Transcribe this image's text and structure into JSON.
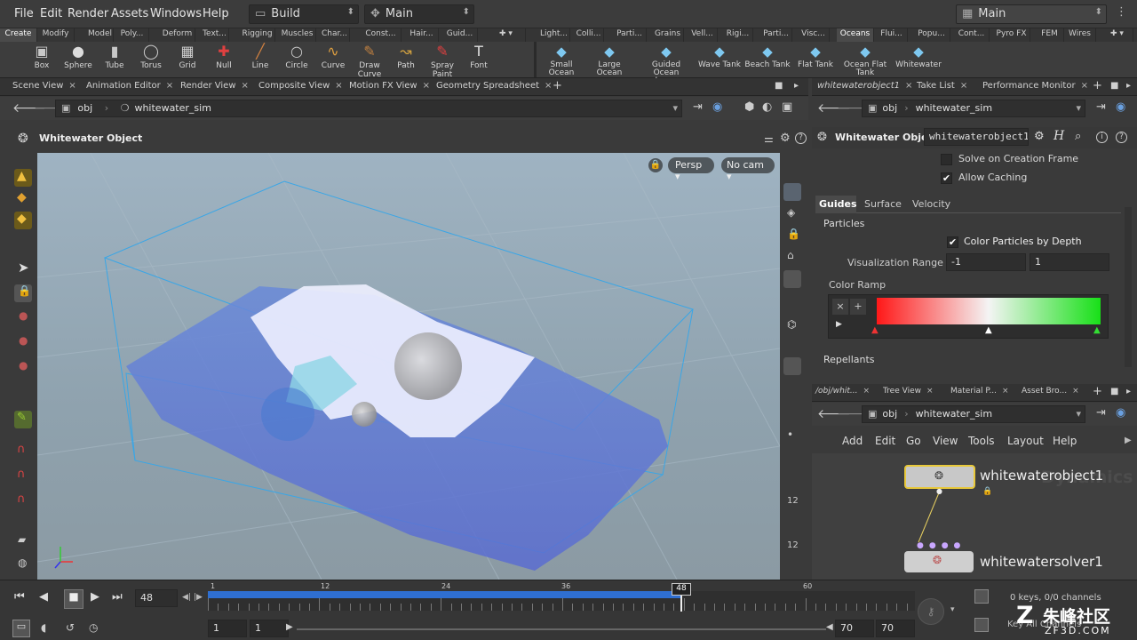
{
  "menubar": {
    "items": [
      "File",
      "Edit",
      "Render",
      "Assets",
      "Windows",
      "Help"
    ],
    "desktop": "Build",
    "context": "Main",
    "right_context": "Main"
  },
  "shelf_tabs_left": [
    "Create",
    "Modify",
    "Model",
    "Poly...",
    "Deform",
    "Text...",
    "Rigging",
    "Muscles",
    "Char...",
    "Const...",
    "Hair...",
    "Guid..."
  ],
  "shelf_tabs_right": [
    "Light...",
    "Colli...",
    "Parti...",
    "Grains",
    "Vell...",
    "Rigi...",
    "Parti...",
    "Visc...",
    "Oceans",
    "Flui...",
    "Popu...",
    "Cont...",
    "Pyro FX",
    "FEM",
    "Wires"
  ],
  "tools_left": [
    "Box",
    "Sphere",
    "Tube",
    "Torus",
    "Grid",
    "Null",
    "Line",
    "Circle",
    "Curve",
    "Draw Curve",
    "Path",
    "Spray Paint",
    "Font"
  ],
  "tools_right": [
    "Small Ocean",
    "Large Ocean",
    "Guided Ocean Layer",
    "Wave Tank",
    "Beach Tank",
    "Flat Tank",
    "Ocean Flat Tank",
    "Whitewater"
  ],
  "left_pane_tabs": [
    "Scene View",
    "Animation Editor",
    "Render View",
    "Composite View",
    "Motion FX View",
    "Geometry Spreadsheet"
  ],
  "path": {
    "root": "obj",
    "node": "whitewater_sim"
  },
  "viewport": {
    "title": "Whitewater Object",
    "camera_mode": "Persp",
    "camera": "No cam"
  },
  "parm": {
    "tabs": [
      "whitewaterobject1",
      "Take List",
      "Performance Monitor"
    ],
    "path_root": "obj",
    "path_node": "whitewater_sim",
    "type": "Whitewater Object",
    "name": "whitewaterobject1",
    "solve_on_creation": "Solve on Creation Frame",
    "allow_caching": "Allow Caching",
    "subtabs": [
      "Guides",
      "Surface",
      "Velocity"
    ],
    "particles_section": "Particles",
    "color_by_depth": "Color Particles by Depth",
    "vis_range_label": "Visualization Range",
    "vis_min": "-1",
    "vis_max": "1",
    "color_ramp_label": "Color Ramp",
    "repellants": "Repellants"
  },
  "net": {
    "tabs": [
      "/obj/whit...",
      "Tree View",
      "Material P...",
      "Asset Bro..."
    ],
    "path_root": "obj",
    "path_node": "whitewater_sim",
    "menu": [
      "Add",
      "Edit",
      "Go",
      "View",
      "Tools",
      "Layout",
      "Help"
    ],
    "node1": "whitewaterobject1",
    "node2": "whitewatersolver1",
    "watermark": "Dynamics"
  },
  "timeline": {
    "current_frame": "48",
    "ticks": [
      "1",
      "12",
      "24",
      "36",
      "48",
      "60"
    ],
    "start": "1",
    "start2": "1",
    "end": "70",
    "end2": "70",
    "keys": "0 keys, 0/0 channels",
    "key_label": "Key All Channels"
  },
  "brand": {
    "logo_text": "朱峰社区",
    "url": "ZF3D.COM"
  },
  "colors": {
    "accent": "#2f6fd1",
    "node_selected": "#e8c83a",
    "ramp_left": "#ff2020",
    "ramp_right": "#20e020"
  }
}
